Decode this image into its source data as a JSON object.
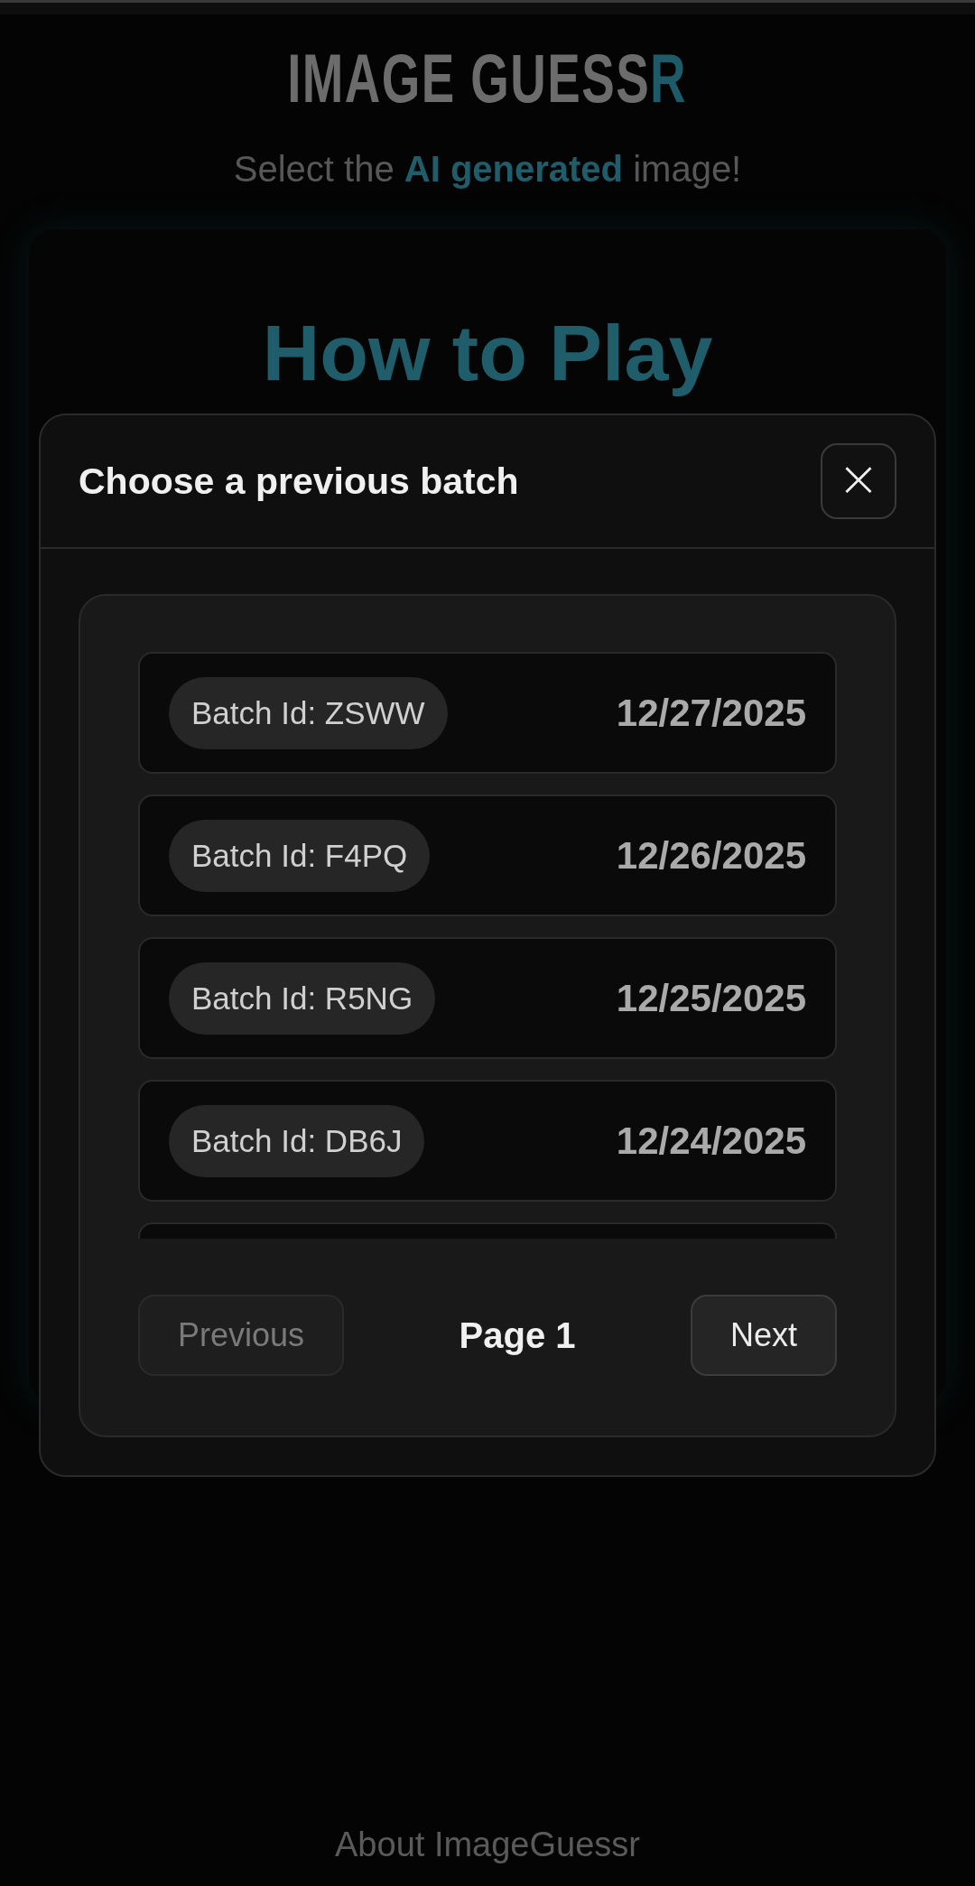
{
  "header": {
    "title": "IMAGE GUESS",
    "title_accent": "R",
    "subtitle": "Select the **AI generated** image!"
  },
  "card": {
    "heading": "How to Play"
  },
  "modal": {
    "title": "Choose a previous batch",
    "close_icon": "×",
    "batches": [
      {
        "label": "Batch Id: ZSWW",
        "date": "12/27/2025"
      },
      {
        "label": "Batch Id: F4PQ",
        "date": "12/26/2025"
      },
      {
        "label": "Batch Id: R5NG",
        "date": "12/25/2025"
      },
      {
        "label": "Batch Id: DB6J",
        "date": "12/24/2025"
      }
    ],
    "pagination": {
      "previous": {
        "label": "Previous",
        "disabled": true
      },
      "page": "Page 1",
      "next": {
        "label": "Next",
        "disabled": false
      }
    }
  },
  "footer": {
    "link": "About ImageGuessr"
  }
}
